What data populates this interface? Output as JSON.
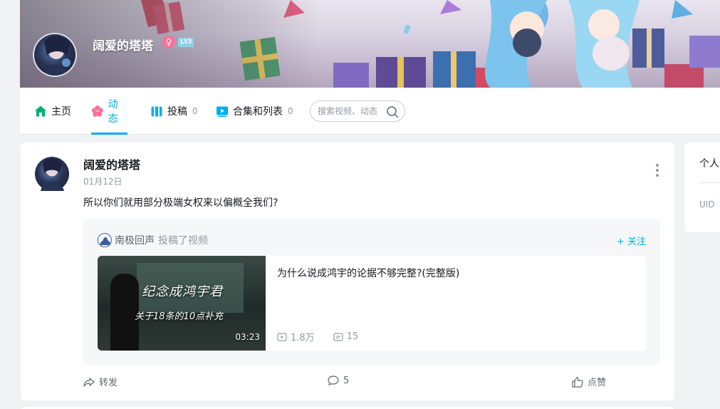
{
  "profile": {
    "name": "阔爱的塔塔",
    "gender_symbol": "♀",
    "level": "LV3"
  },
  "nav": {
    "items": [
      {
        "label": "主页",
        "count": ""
      },
      {
        "label": "动态",
        "count": ""
      },
      {
        "label": "投稿",
        "count": "0"
      },
      {
        "label": "合集和列表",
        "count": "0"
      }
    ],
    "active": "动态",
    "search_placeholder": "搜索视频、动态"
  },
  "post": {
    "author": "阔爱的塔塔",
    "date": "01月12日",
    "text": "所以你们就用部分极端女权来以偏概全我们?",
    "forward": {
      "up_name": "南极回声",
      "action": "投稿了视频",
      "follow_label": "+ 关注",
      "video": {
        "title": "为什么说成鸿宇的论据不够完整?(完整版)",
        "cover_text_1": "纪念成鸿宇君",
        "cover_text_2": "关于18条的10点补充",
        "duration": "03:23",
        "views": "1.8万",
        "danmaku": "15"
      }
    },
    "actions": {
      "share": "转发",
      "comment": "5",
      "like": "点赞"
    }
  },
  "side": {
    "title": "个人资料",
    "uid_label": "UID"
  },
  "colors": {
    "accent": "#00aeec",
    "pink": "#fb7299",
    "home_green": "#00b070"
  }
}
